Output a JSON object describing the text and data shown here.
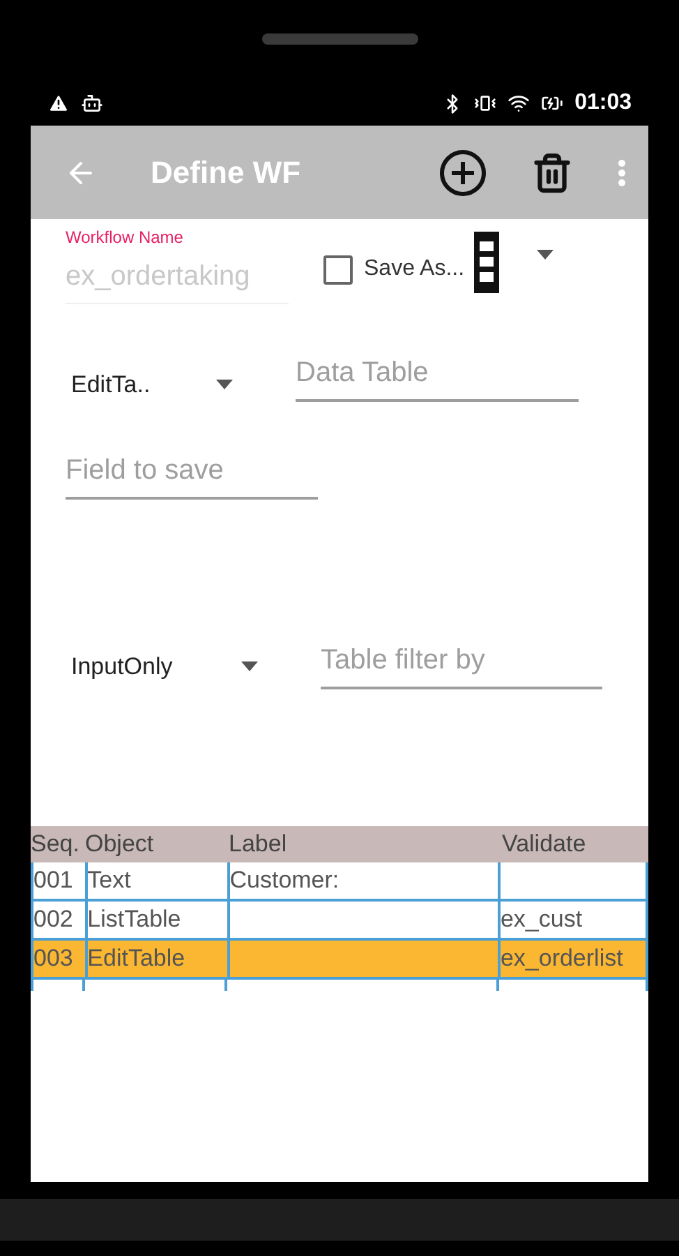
{
  "status_bar": {
    "time": "01:03"
  },
  "app_bar": {
    "title": "Define WF"
  },
  "workflow_name": {
    "label": "Workflow Name",
    "placeholder": "ex_ordertaking"
  },
  "save_as": {
    "label": "Save As...",
    "checked": false
  },
  "object_dropdown": {
    "value": "EditTa.."
  },
  "data_table": {
    "placeholder": "Data Table"
  },
  "field_to_save": {
    "placeholder": "Field to save"
  },
  "mode_dropdown": {
    "value": "InputOnly"
  },
  "table_filter": {
    "placeholder": "Table filter by"
  },
  "table": {
    "columns": [
      "Seq.",
      "Object",
      "Label",
      "Validate"
    ],
    "rows": [
      {
        "cells": [
          "001",
          "Text",
          "Customer:",
          ""
        ],
        "selected": false
      },
      {
        "cells": [
          "002",
          "ListTable",
          "",
          "ex_cust"
        ],
        "selected": false
      },
      {
        "cells": [
          "003",
          "EditTable",
          "",
          "ex_orderlist"
        ],
        "selected": true
      }
    ]
  }
}
